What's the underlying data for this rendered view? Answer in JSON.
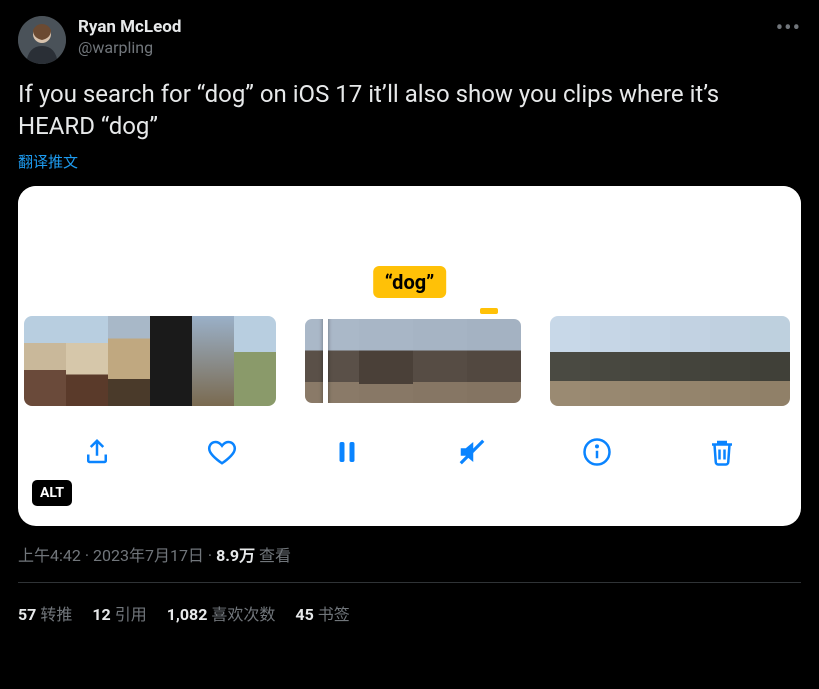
{
  "author": {
    "display_name": "Ryan McLeod",
    "handle": "@warpling"
  },
  "body": "If you search for “dog” on iOS 17 it’ll also show you clips where it’s HEARD “dog”",
  "translate_label": "翻译推文",
  "media": {
    "search_term": "“dog”",
    "alt_badge": "ALT",
    "toolbar": {
      "share": "share-icon",
      "like": "heart-icon",
      "pause": "pause-icon",
      "mute": "mute-icon",
      "info": "info-icon",
      "delete": "trash-icon"
    }
  },
  "meta": {
    "time": "上午4:42",
    "dot1": " · ",
    "date": "2023年7月17日",
    "dot2": " · ",
    "views_count": "8.9万",
    "views_label": " 查看"
  },
  "stats": {
    "retweets_count": "57",
    "retweets_label": "转推",
    "quotes_count": "12",
    "quotes_label": "引用",
    "likes_count": "1,082",
    "likes_label": "喜欢次数",
    "bookmarks_count": "45",
    "bookmarks_label": "书签"
  }
}
